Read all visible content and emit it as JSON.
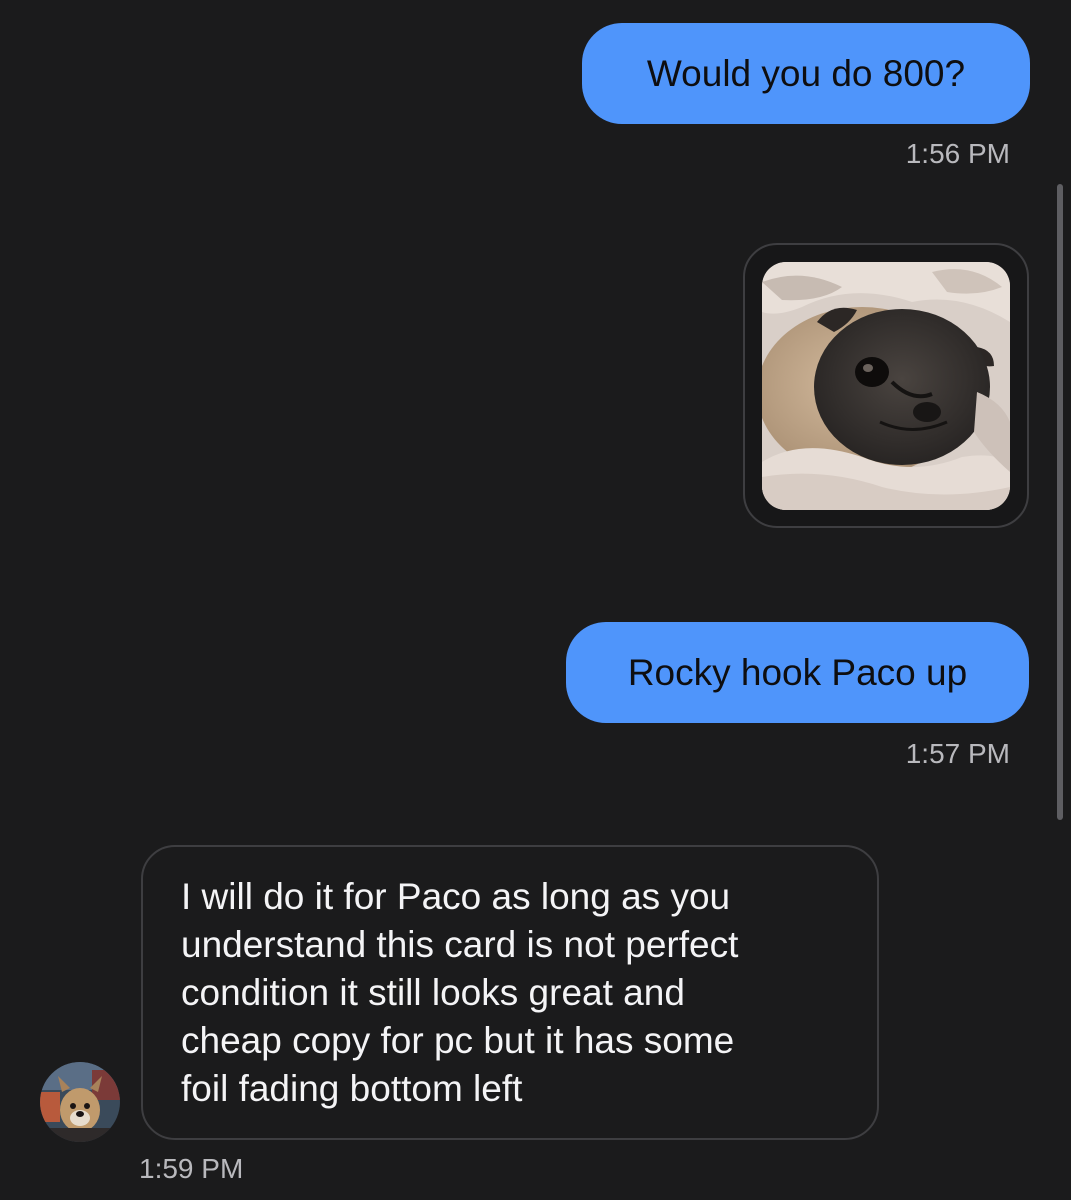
{
  "conversation": {
    "messages": [
      {
        "direction": "outgoing",
        "type": "text",
        "text": "Would you do 800?",
        "time": "1:56 PM"
      },
      {
        "direction": "outgoing",
        "type": "image",
        "image_icon": "pug-photo"
      },
      {
        "direction": "outgoing",
        "type": "text",
        "text": "Rocky hook Paco up",
        "time": "1:57 PM"
      },
      {
        "direction": "incoming",
        "type": "text",
        "text": "I will do it for Paco as long as you\nunderstand this card is not perfect\ncondition it still looks great and\ncheap copy for pc but it has some\nfoil fading bottom left",
        "time": "1:59 PM",
        "avatar_icon": "dog-avatar"
      }
    ]
  },
  "colors": {
    "background": "#1b1b1c",
    "outgoing_bubble": "#4f95fb",
    "incoming_border": "#3e3e41",
    "timestamp_text": "#b9b9bd",
    "incoming_text": "#f4f4f6"
  }
}
